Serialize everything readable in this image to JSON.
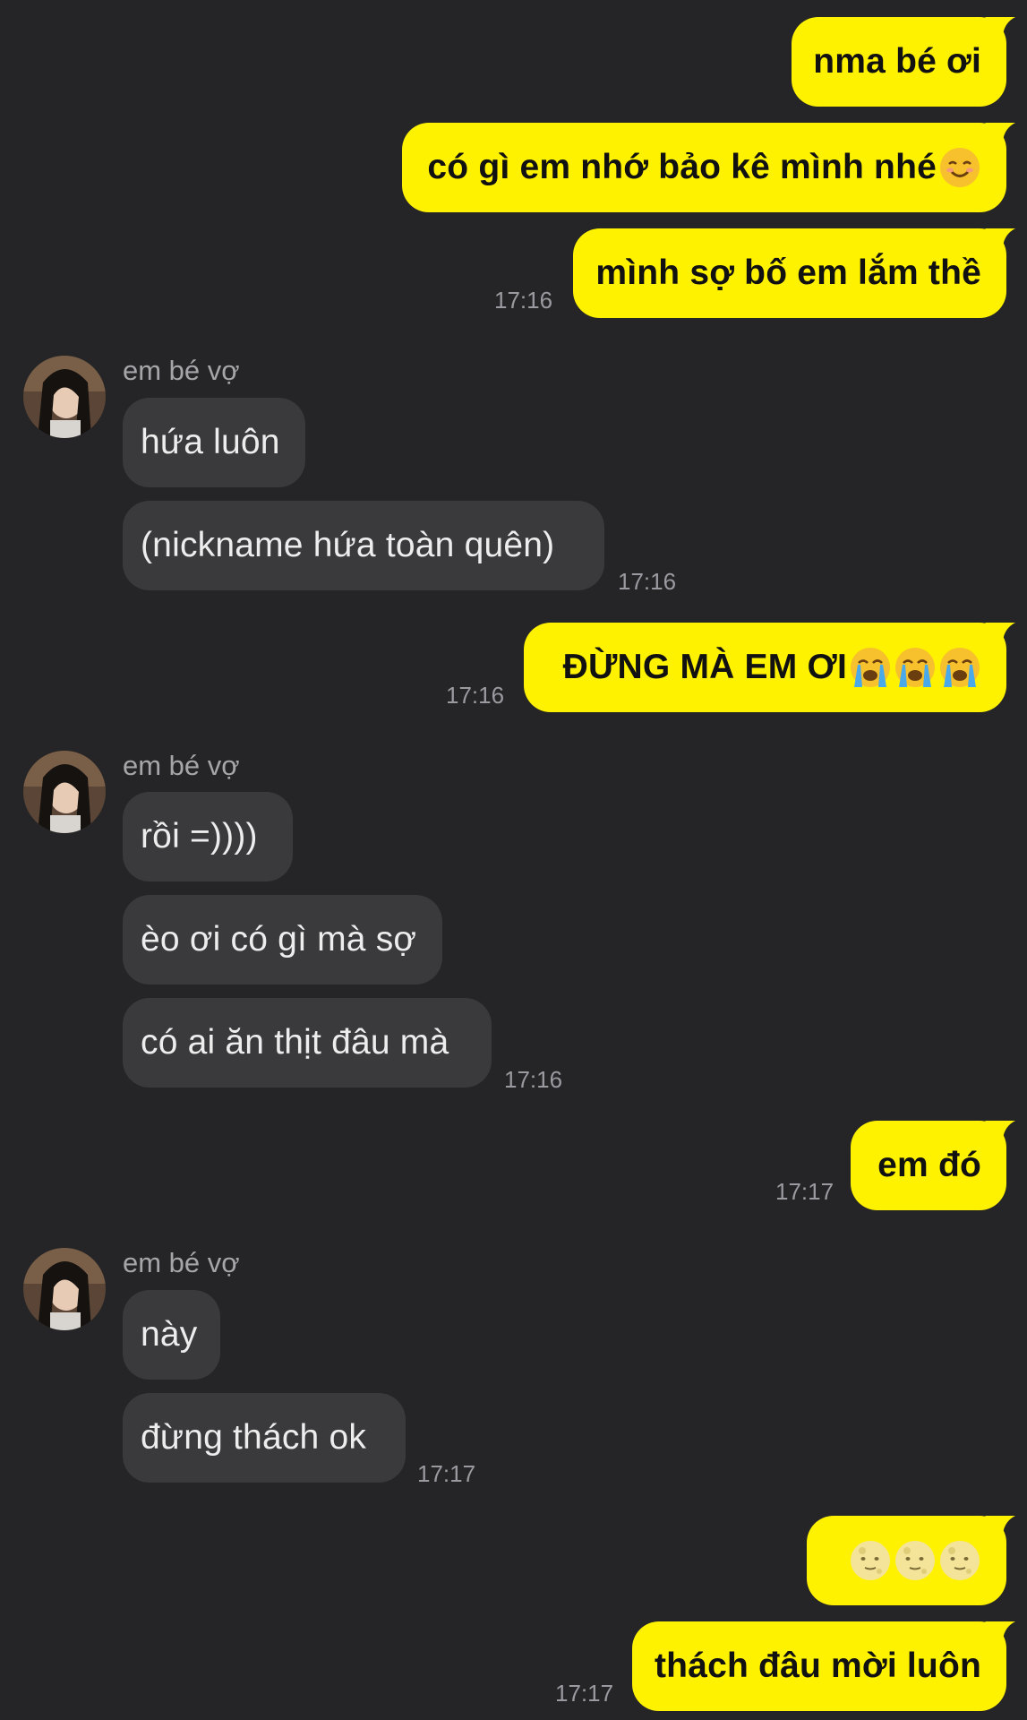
{
  "contact": {
    "name": "em bé vợ"
  },
  "colors": {
    "background": "#252527",
    "outgoing": "#fff200",
    "incoming": "#3a3a3d"
  },
  "messages": [
    {
      "side": "out",
      "text": "nma bé ơi"
    },
    {
      "side": "out",
      "text": "có gì em nhớ bảo kê mình nhé",
      "emoji": [
        "smiling-face-icon"
      ]
    },
    {
      "side": "out",
      "text": "mình sợ bố em lắm thề",
      "time": "17:16"
    },
    {
      "side": "in",
      "text": "hứa luôn"
    },
    {
      "side": "in",
      "text": "(nickname hứa toàn quên)",
      "time": "17:16"
    },
    {
      "side": "out",
      "text": "ĐỪNG MÀ EM ƠI",
      "emoji": [
        "loudly-crying-face-icon",
        "loudly-crying-face-icon",
        "loudly-crying-face-icon"
      ],
      "time": "17:16"
    },
    {
      "side": "in",
      "text": "rồi =))))"
    },
    {
      "side": "in",
      "text": "èo ơi có gì mà sợ"
    },
    {
      "side": "in",
      "text": "có ai ăn thịt đâu mà",
      "time": "17:16"
    },
    {
      "side": "out",
      "text": "em đó",
      "time": "17:17"
    },
    {
      "side": "in",
      "text": "này"
    },
    {
      "side": "in",
      "text": "đừng thách ok",
      "time": "17:17"
    },
    {
      "side": "out",
      "text": "",
      "emoji": [
        "full-moon-face-icon",
        "full-moon-face-icon",
        "full-moon-face-icon"
      ]
    },
    {
      "side": "out",
      "text": "thách đâu mời luôn",
      "time": "17:17"
    }
  ]
}
